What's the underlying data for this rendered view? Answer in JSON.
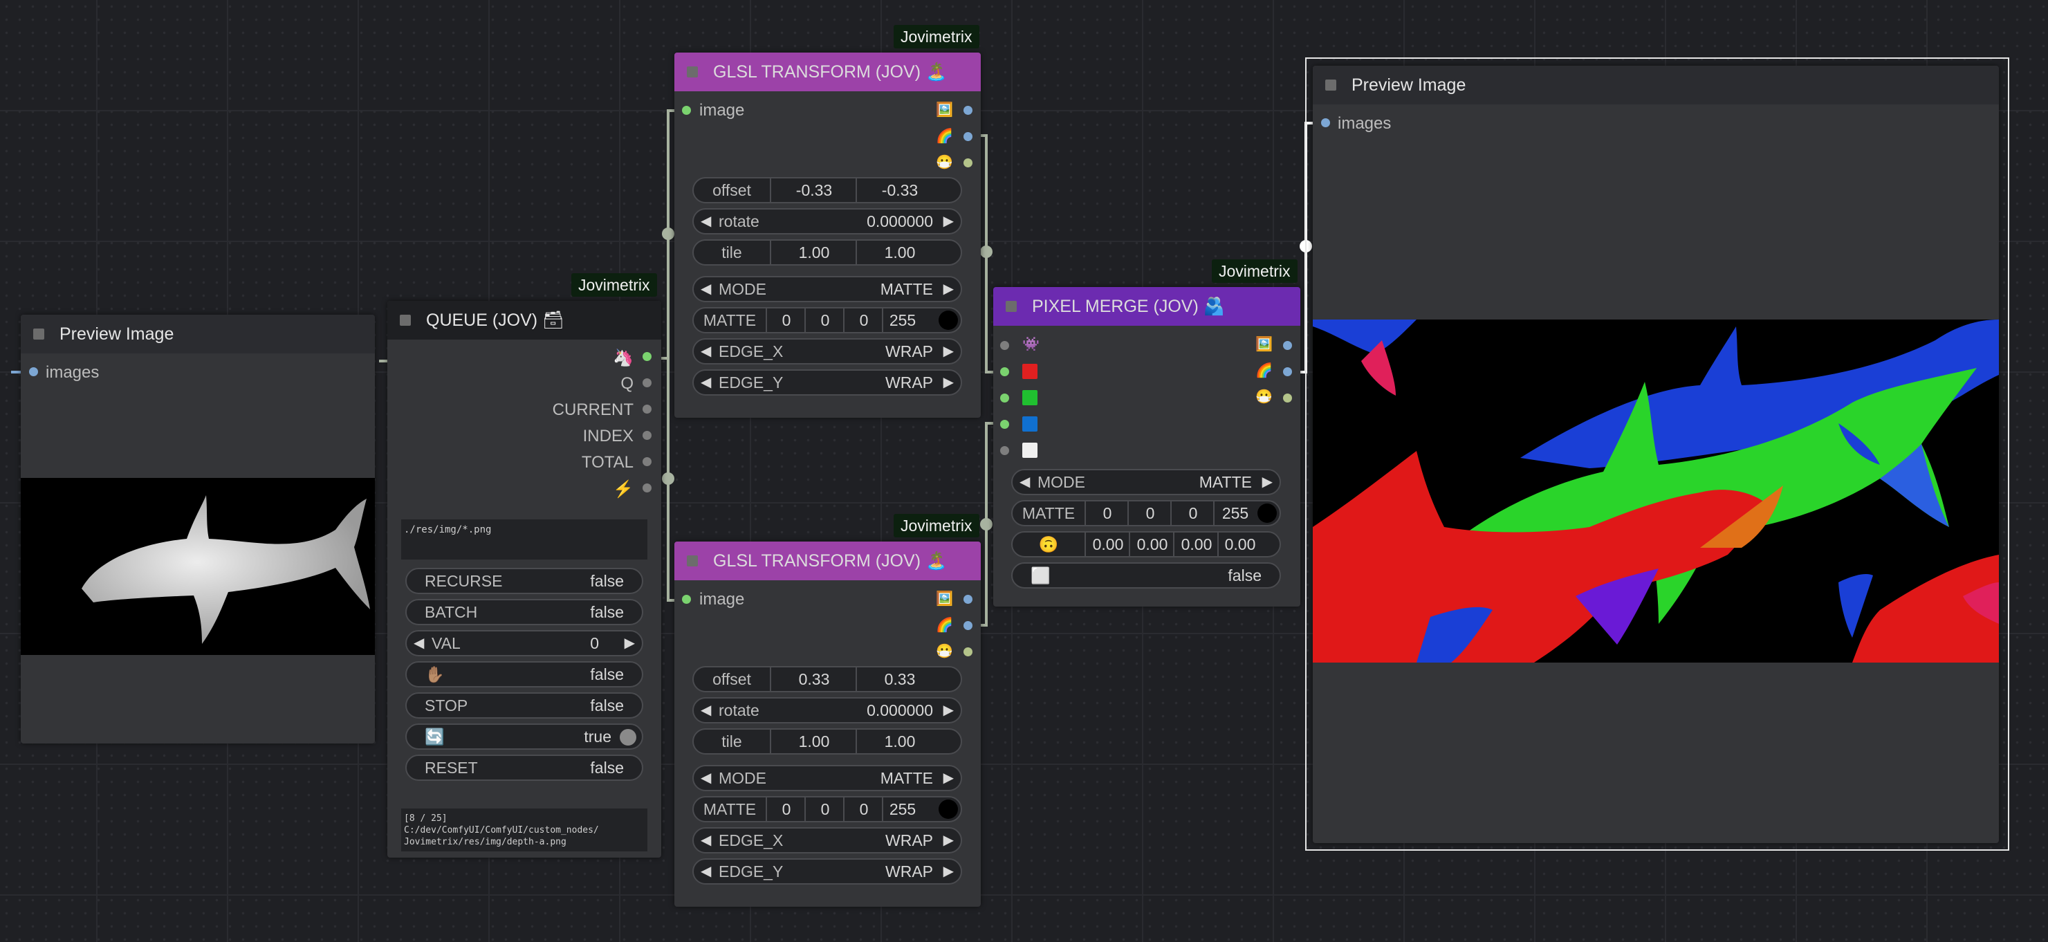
{
  "badge_text": "Jovimetrix",
  "preview_left": {
    "title": "Preview Image",
    "input": "images"
  },
  "queue": {
    "title": "QUEUE (JOV) 🗃",
    "outputs": [
      "🦄",
      "Q",
      "CURRENT",
      "INDEX",
      "TOTAL",
      "⚡"
    ],
    "path": "./res/img/*.png",
    "widgets": [
      {
        "label": "RECURSE",
        "value": "false"
      },
      {
        "label": "BATCH",
        "value": "false"
      },
      {
        "label": "VAL",
        "value": "0"
      },
      {
        "label": "✋🏽",
        "value": "false"
      },
      {
        "label": "STOP",
        "value": "false"
      },
      {
        "label": "🔄",
        "value": "true"
      },
      {
        "label": "RESET",
        "value": "false"
      }
    ],
    "status": "[8 / 25]\nC:/dev/ComfyUI/ComfyUI/custom_nodes/\nJovimetrix/res/img/depth-a.png"
  },
  "glsl_top": {
    "title": "GLSL TRANSFORM (JOV) 🏝️",
    "input": "image",
    "outputs": [
      "🖼️",
      "🌈",
      "😷"
    ],
    "offset": {
      "label": "offset",
      "x": "-0.33",
      "y": "-0.33"
    },
    "rotate": {
      "label": "rotate",
      "value": "0.000000"
    },
    "tile": {
      "label": "tile",
      "x": "1.00",
      "y": "1.00"
    },
    "mode": {
      "label": "MODE",
      "value": "MATTE"
    },
    "matte": {
      "label": "MATTE",
      "r": "0",
      "g": "0",
      "b": "0",
      "a": "255"
    },
    "edge_x": {
      "label": "EDGE_X",
      "value": "WRAP"
    },
    "edge_y": {
      "label": "EDGE_Y",
      "value": "WRAP"
    }
  },
  "glsl_bottom": {
    "title": "GLSL TRANSFORM (JOV) 🏝️",
    "input": "image",
    "outputs": [
      "🖼️",
      "🌈",
      "😷"
    ],
    "offset": {
      "label": "offset",
      "x": "0.33",
      "y": "0.33"
    },
    "rotate": {
      "label": "rotate",
      "value": "0.000000"
    },
    "tile": {
      "label": "tile",
      "x": "1.00",
      "y": "1.00"
    },
    "mode": {
      "label": "MODE",
      "value": "MATTE"
    },
    "matte": {
      "label": "MATTE",
      "r": "0",
      "g": "0",
      "b": "0",
      "a": "255"
    },
    "edge_x": {
      "label": "EDGE_X",
      "value": "WRAP"
    },
    "edge_y": {
      "label": "EDGE_Y",
      "value": "WRAP"
    }
  },
  "pixel_merge": {
    "title": "PIXEL MERGE (JOV) 🫂",
    "input_icon": "👾",
    "channel_colors": {
      "red": "#e02020",
      "green": "#20c030",
      "blue": "#1070d0",
      "white": "#f0f0f0"
    },
    "outputs": [
      "🖼️",
      "🌈",
      "😷"
    ],
    "mode": {
      "label": "MODE",
      "value": "MATTE"
    },
    "matte": {
      "label": "MATTE",
      "r": "0",
      "g": "0",
      "b": "0",
      "a": "255"
    },
    "flip": {
      "label": "🙃",
      "v1": "0.00",
      "v2": "0.00",
      "v3": "0.00",
      "v4": "0.00"
    },
    "invert": {
      "label": "⬜",
      "value": "false"
    }
  },
  "preview_right": {
    "title": "Preview Image",
    "input": "images"
  }
}
